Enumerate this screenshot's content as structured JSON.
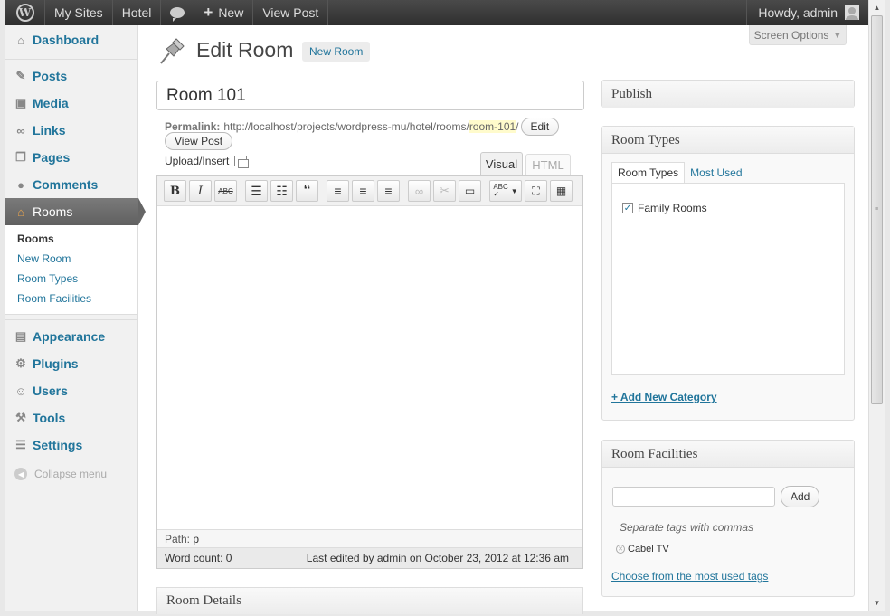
{
  "adminbar": {
    "my_sites": "My Sites",
    "site": "Hotel",
    "new": "New",
    "view_post": "View Post",
    "greeting": "Howdy, admin"
  },
  "screen_options": "Screen Options",
  "sidebar": {
    "items": [
      {
        "label": "Dashboard",
        "icon": "home-icon"
      },
      {
        "label": "Posts",
        "icon": "pin-icon"
      },
      {
        "label": "Media",
        "icon": "media-icon"
      },
      {
        "label": "Links",
        "icon": "link-icon"
      },
      {
        "label": "Pages",
        "icon": "pages-icon"
      },
      {
        "label": "Comments",
        "icon": "comments-icon"
      },
      {
        "label": "Rooms",
        "icon": "house-icon"
      },
      {
        "label": "Appearance",
        "icon": "appearance-icon"
      },
      {
        "label": "Plugins",
        "icon": "plugins-icon"
      },
      {
        "label": "Users",
        "icon": "users-icon"
      },
      {
        "label": "Tools",
        "icon": "tools-icon"
      },
      {
        "label": "Settings",
        "icon": "settings-icon"
      }
    ],
    "submenu": [
      "Rooms",
      "New Room",
      "Room Types",
      "Room Facilities"
    ],
    "collapse": "Collapse menu"
  },
  "heading": {
    "title": "Edit Room",
    "add_new": "New Room"
  },
  "post": {
    "title": "Room 101",
    "permalink_label": "Permalink:",
    "permalink_base": "http://localhost/projects/wordpress-mu/hotel/rooms/",
    "permalink_slug": "room-101",
    "permalink_end": "/",
    "edit_btn": "Edit",
    "view_post_btn": "View Post",
    "upload_insert": "Upload/Insert"
  },
  "editor": {
    "tab_visual": "Visual",
    "tab_html": "HTML",
    "path_label": "Path:",
    "path_value": "p",
    "word_count": "Word count: 0",
    "last_edited": "Last edited by admin on October 23, 2012 at 12:36 am"
  },
  "room_details": "Room Details",
  "publish": {
    "title": "Publish"
  },
  "room_types": {
    "title": "Room Types",
    "tab_all": "Room Types",
    "tab_used": "Most Used",
    "items": [
      {
        "label": "Family Rooms",
        "checked": true
      }
    ],
    "add_new": "+ Add New Category"
  },
  "room_facilities": {
    "title": "Room Facilities",
    "add_btn": "Add",
    "hint": "Separate tags with commas",
    "tags": [
      "Cabel TV"
    ],
    "choose": "Choose from the most used tags"
  }
}
